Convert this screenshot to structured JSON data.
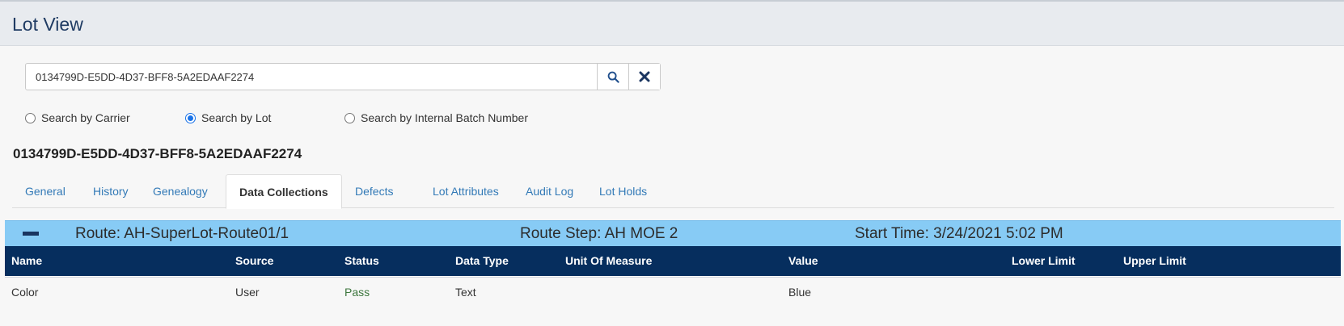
{
  "page": {
    "title": "Lot View"
  },
  "search": {
    "value": "0134799D-E5DD-4D37-BFF8-5A2EDAAF2274",
    "search_icon": "search-icon",
    "clear_icon": "close-icon"
  },
  "search_modes": [
    {
      "label": "Search by Carrier",
      "checked": false
    },
    {
      "label": "Search by Lot",
      "checked": true
    },
    {
      "label": "Search by Internal Batch Number",
      "checked": false
    }
  ],
  "lot_id": "0134799D-E5DD-4D37-BFF8-5A2EDAAF2274",
  "tabs": [
    {
      "label": "General"
    },
    {
      "label": "History"
    },
    {
      "label": "Genealogy"
    },
    {
      "label": "Data Collections",
      "active": true
    },
    {
      "label": "Defects"
    },
    {
      "label": "Lot Attributes"
    },
    {
      "label": "Audit Log"
    },
    {
      "label": "Lot Holds"
    }
  ],
  "route_group": {
    "route": "Route: AH-SuperLot-Route01/1",
    "route_step": "Route Step: AH MOE 2",
    "start_time": "Start Time: 3/24/2021 5:02 PM",
    "collapse_icon": "minus-icon"
  },
  "grid": {
    "columns": [
      "Name",
      "Source",
      "Status",
      "Data Type",
      "Unit Of Measure",
      "Value",
      "Lower Limit",
      "Upper Limit"
    ],
    "rows": [
      [
        "Color",
        "User",
        "Pass",
        "Text",
        "",
        "Blue",
        "",
        ""
      ]
    ]
  },
  "colors": {
    "header_bg": "#e8ebef",
    "route_bar": "#87cbf5",
    "grid_header": "#062e5e",
    "link": "#337ab7",
    "pass": "#3c763d"
  }
}
